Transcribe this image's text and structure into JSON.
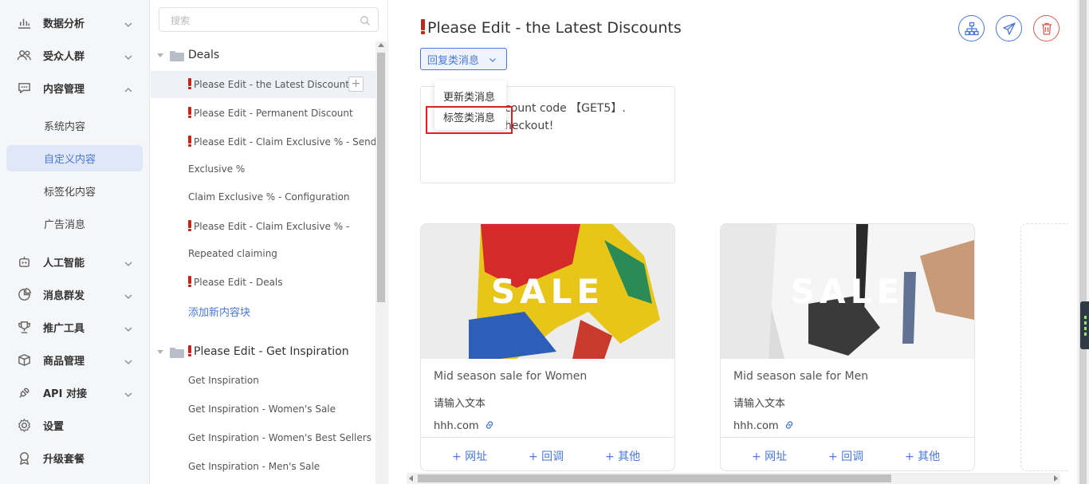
{
  "nav": {
    "items": [
      {
        "label": "数据分析",
        "icon": "bar-chart-icon"
      },
      {
        "label": "受众人群",
        "icon": "people-icon"
      },
      {
        "label": "内容管理",
        "icon": "chat-bubble-icon"
      },
      {
        "label": "人工智能",
        "icon": "robot-icon"
      },
      {
        "label": "消息群发",
        "icon": "pie-clock-icon"
      },
      {
        "label": "推广工具",
        "icon": "trophy-icon"
      },
      {
        "label": "商品管理",
        "icon": "box-icon"
      },
      {
        "label": "API 对接",
        "icon": "plug-icon"
      },
      {
        "label": "设置",
        "icon": "gear-icon"
      },
      {
        "label": "升级套餐",
        "icon": "badge-icon"
      }
    ],
    "content_sub": [
      "系统内容",
      "自定义内容",
      "标签化内容",
      "广告消息"
    ]
  },
  "tree": {
    "search_placeholder": "搜索",
    "group1": "Deals",
    "leaf_selected": "Please Edit - the Latest Discounts",
    "leaf2": "Please Edit - Permanent Discount",
    "leaf3_a": "Please Edit - Claim Exclusive % - Send",
    "leaf3_b": "Exclusive %",
    "leaf4": "Claim Exclusive % - Configuration",
    "leaf5_a": "Please Edit - Claim Exclusive % -",
    "leaf5_b": "Repeated claiming",
    "leaf6": "Please Edit - Deals",
    "add_link": "添加新内容块",
    "group2": "Please Edit - Get Inspiration",
    "g2_items": [
      "Get Inspiration",
      "Get Inspiration - Women's Sale",
      "Get Inspiration - Women's Best Sellers",
      "Get Inspiration - Men's Sale"
    ]
  },
  "main": {
    "title": "Please Edit - the Latest Discounts",
    "dropdown_label": "回复类消息",
    "menu": [
      "更新类消息",
      "标签类消息"
    ],
    "text_line1": "count code 【GET5】.",
    "text_line2": "heckout!",
    "cards": [
      {
        "banner": "SALE",
        "name": "Mid season sale for Women",
        "desc": "请输入文本",
        "link": "hhh.com",
        "actions": [
          "+ 网址",
          "+ 回调",
          "+ 其他"
        ]
      },
      {
        "banner": "SALE",
        "name": "Mid season sale for Men",
        "desc": "请输入文本",
        "link": "hhh.com",
        "actions": [
          "+ 网址",
          "+ 回调",
          "+ 其他"
        ]
      }
    ]
  },
  "colors": {
    "accent": "#4a78d8",
    "danger": "#e05a4f",
    "highlight": "#e02020"
  }
}
